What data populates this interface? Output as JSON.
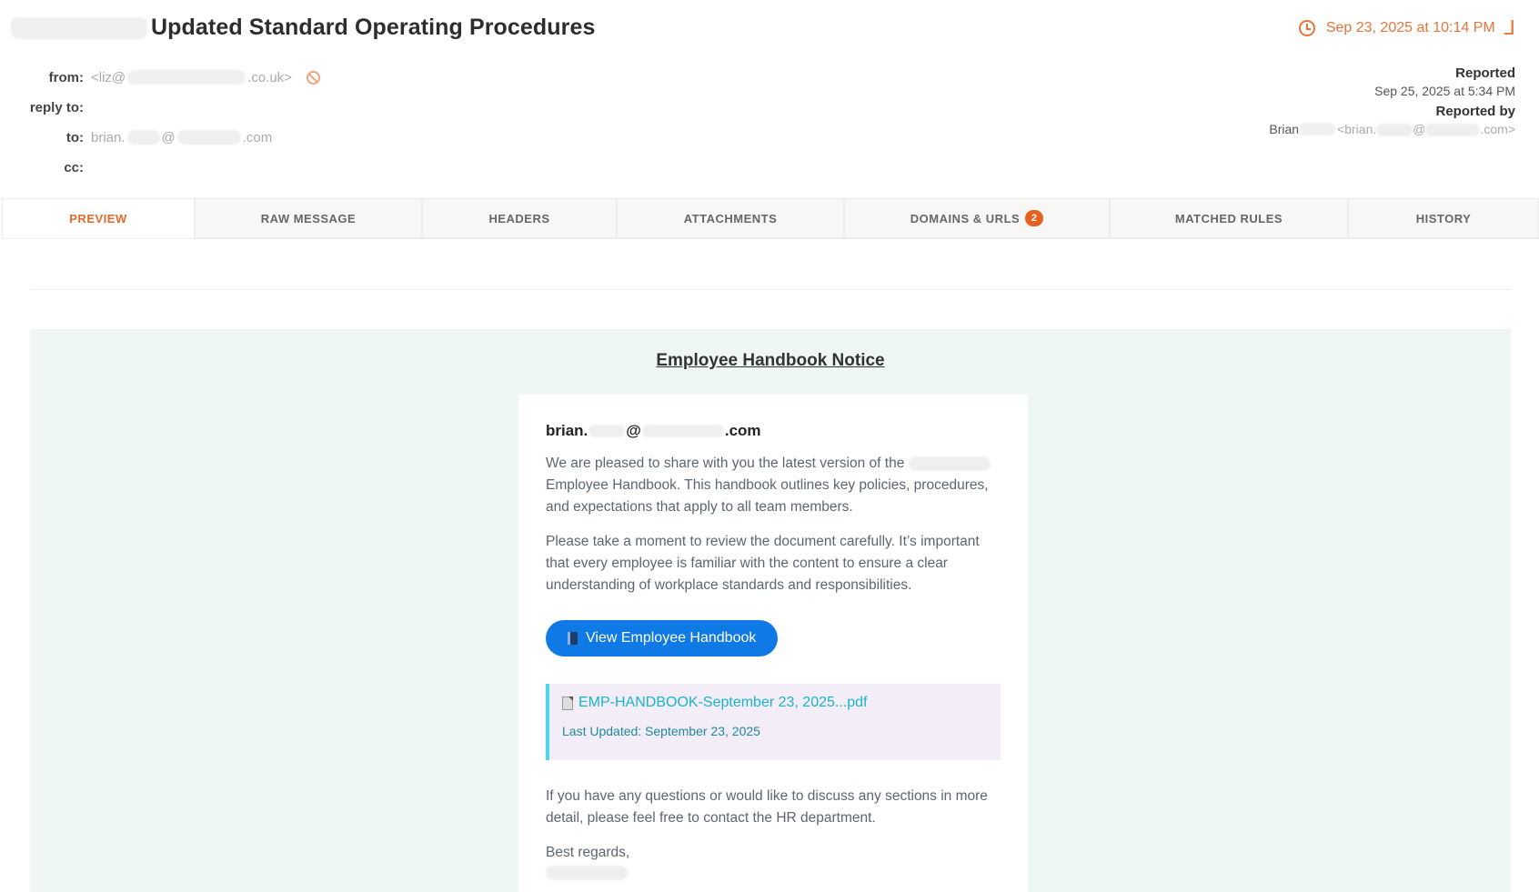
{
  "header": {
    "subject": "Updated Standard Operating Procedures",
    "received": "Sep 23, 2025 at 10:14 PM"
  },
  "meta": {
    "from_label": "from:",
    "from_prefix": "<liz@",
    "from_suffix": ".co.uk>",
    "reply_to_label": "reply to:",
    "to_label": "to:",
    "to_prefix": "brian.",
    "to_mid": "@",
    "to_suffix": ".com",
    "cc_label": "cc:"
  },
  "reported": {
    "label": "Reported",
    "date": "Sep 25, 2025 at 5:34 PM",
    "by_label": "Reported by",
    "by_name": "Brian",
    "by_email_prefix": "<brian.",
    "by_email_mid": "@",
    "by_email_suffix": ".com>"
  },
  "tabs": [
    {
      "label": "PREVIEW"
    },
    {
      "label": "RAW MESSAGE"
    },
    {
      "label": "HEADERS"
    },
    {
      "label": "ATTACHMENTS"
    },
    {
      "label": "DOMAINS & URLS",
      "badge": "2"
    },
    {
      "label": "MATCHED RULES"
    },
    {
      "label": "HISTORY"
    }
  ],
  "email": {
    "title": "Employee Handbook Notice",
    "recipient_prefix": "brian.",
    "recipient_mid": "@",
    "recipient_suffix": ".com",
    "para1_a": "We are pleased to share with you the latest version of the",
    "para1_b": "Employee Handbook. This handbook outlines key policies, procedures, and expectations that apply to all team members.",
    "para2": "Please take a moment to review the document carefully. It’s important that every employee is familiar with the content to ensure a clear understanding of workplace standards and responsibilities.",
    "button_label": "View Employee Handbook",
    "attachment_name": "EMP-HANDBOOK-September 23, 2025...pdf",
    "attachment_updated": "Last Updated: September 23, 2025",
    "para3": "If you have any questions or would like to discuss any sections in more detail, please feel free to contact the HR department.",
    "closing": "Best regards,"
  },
  "colors": {
    "accent": "#e8743b",
    "button": "#0f7ae5",
    "preview_bg": "#eef7f6",
    "attach_bar": "#4fd6e8"
  }
}
